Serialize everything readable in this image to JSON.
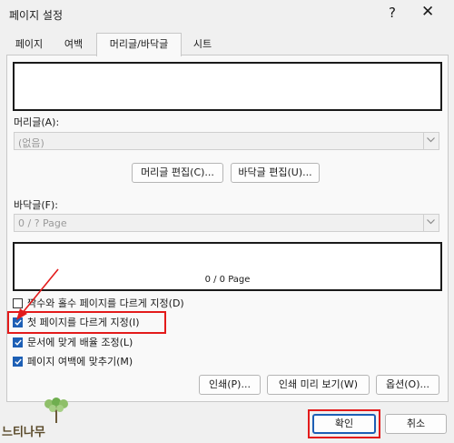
{
  "window": {
    "title": "페이지 설정",
    "help": "?",
    "close": "✕"
  },
  "tabs": [
    {
      "label": "페이지"
    },
    {
      "label": "여백"
    },
    {
      "label": "머리글/바닥글",
      "active": true
    },
    {
      "label": "시트"
    }
  ],
  "header": {
    "label": "머리글(A):",
    "value": "(없음)",
    "edit_header_button": "머리글 편집(C)...",
    "edit_footer_button": "바닥글 편집(U)..."
  },
  "footer": {
    "label": "바닥글(F):",
    "value": "0 / ? Page",
    "preview_text": "0 / 0 Page"
  },
  "options": [
    {
      "label": "짝수와 홀수 페이지를 다르게 지정(D)",
      "checked": false
    },
    {
      "label": "첫 페이지를 다르게 지정(I)",
      "checked": true
    },
    {
      "label": "문서에 맞게 배율 조정(L)",
      "checked": true
    },
    {
      "label": "페이지 여백에 맞추기(M)",
      "checked": true
    }
  ],
  "buttons": {
    "print": "인쇄(P)...",
    "print_preview": "인쇄 미리 보기(W)",
    "options": "옵션(O)...",
    "ok": "확인",
    "cancel": "취소"
  },
  "logo": {
    "text": "느티나무"
  },
  "colors": {
    "accent": "#1d5fb5",
    "highlight": "#e31b1b"
  }
}
